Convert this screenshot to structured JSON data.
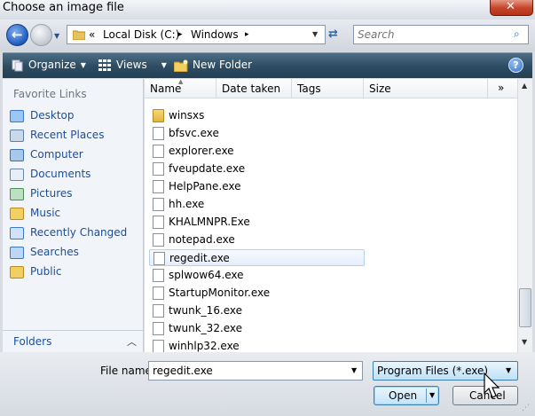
{
  "window": {
    "title": "Choose an image file"
  },
  "address": {
    "overflow": "«",
    "crumbs": [
      "Local Disk (C:)",
      "Windows"
    ],
    "separator": "▸"
  },
  "search": {
    "placeholder": "Search"
  },
  "toolbar": {
    "organize": "Organize",
    "views": "Views",
    "new_folder": "New Folder",
    "help": "?"
  },
  "navpane": {
    "favorites_title": "Favorite Links",
    "items": [
      {
        "label": "Desktop",
        "icon": "desktop-icon"
      },
      {
        "label": "Recent Places",
        "icon": "recent-places-icon"
      },
      {
        "label": "Computer",
        "icon": "computer-icon"
      },
      {
        "label": "Documents",
        "icon": "documents-icon"
      },
      {
        "label": "Pictures",
        "icon": "pictures-icon"
      },
      {
        "label": "Music",
        "icon": "music-folder-icon"
      },
      {
        "label": "Recently Changed",
        "icon": "recently-changed-icon"
      },
      {
        "label": "Searches",
        "icon": "searches-icon"
      },
      {
        "label": "Public",
        "icon": "public-folder-icon"
      }
    ],
    "folders_label": "Folders"
  },
  "columns": {
    "name": "Name",
    "date_taken": "Date taken",
    "tags": "Tags",
    "size": "Size",
    "more": "»"
  },
  "files": [
    {
      "name": "winsxs",
      "type": "folder"
    },
    {
      "name": "bfsvc.exe",
      "type": "file"
    },
    {
      "name": "explorer.exe",
      "type": "file"
    },
    {
      "name": "fveupdate.exe",
      "type": "file"
    },
    {
      "name": "HelpPane.exe",
      "type": "file"
    },
    {
      "name": "hh.exe",
      "type": "file"
    },
    {
      "name": "KHALMNPR.Exe",
      "type": "file"
    },
    {
      "name": "notepad.exe",
      "type": "file"
    },
    {
      "name": "regedit.exe",
      "type": "file",
      "selected": true
    },
    {
      "name": "splwow64.exe",
      "type": "file"
    },
    {
      "name": "StartupMonitor.exe",
      "type": "file"
    },
    {
      "name": "twunk_16.exe",
      "type": "file"
    },
    {
      "name": "twunk_32.exe",
      "type": "file"
    },
    {
      "name": "winhlp32.exe",
      "type": "file"
    }
  ],
  "bottom": {
    "file_name_label": "File name:",
    "file_name_value": "regedit.exe",
    "file_type": "Program Files (*.exe)",
    "open_label": "Open",
    "cancel_label": "Cancel"
  },
  "colors": {
    "toolbar": "#2e4e64",
    "link": "#1a4fa0",
    "selection": "#e4eefb"
  }
}
